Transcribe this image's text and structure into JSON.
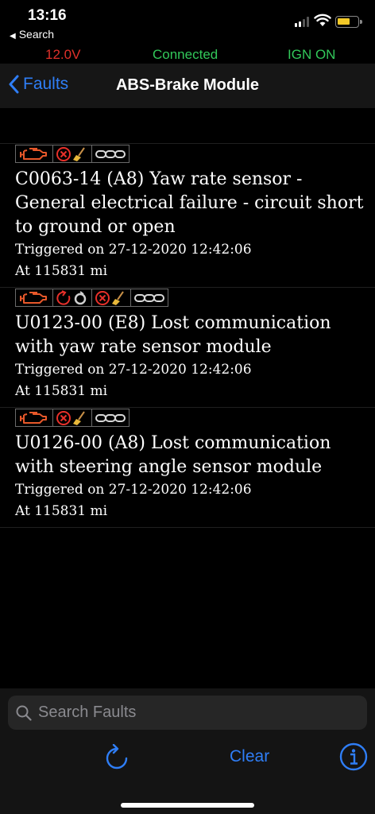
{
  "status_bar": {
    "time": "13:16",
    "back_app": "Search"
  },
  "info_bar": {
    "voltage": "12.0V",
    "connection": "Connected",
    "ignition": "IGN ON"
  },
  "nav": {
    "back_label": "Faults",
    "title": "ABS-Brake Module"
  },
  "faults": [
    {
      "title": "C0063-14 (A8) Yaw rate sensor - General electrical failure - circuit short to ground or open",
      "triggered": "Triggered on 27-12-2020 12:42:06",
      "mileage": "At 115831 mi",
      "badges": [
        "engine-icon",
        "clear-fault-icon",
        "freeze-frame-icon"
      ]
    },
    {
      "title": "U0123-00 (E8) Lost communication with yaw rate sensor module",
      "triggered": "Triggered on 27-12-2020 12:42:06",
      "mileage": "At 115831 mi",
      "badges": [
        "engine-icon",
        "pending-icon",
        "clear-fault-icon",
        "freeze-frame-icon"
      ]
    },
    {
      "title": "U0126-00 (A8) Lost communication with steering angle sensor module",
      "triggered": "Triggered on 27-12-2020 12:42:06",
      "mileage": "At 115831 mi",
      "badges": [
        "engine-icon",
        "clear-fault-icon",
        "freeze-frame-icon"
      ]
    }
  ],
  "search": {
    "placeholder": "Search Faults"
  },
  "toolbar": {
    "clear_label": "Clear"
  },
  "colors": {
    "accent": "#2f7ef6",
    "danger": "#e0302a",
    "ok": "#32c85a",
    "badge_orange": "#e8582a"
  }
}
